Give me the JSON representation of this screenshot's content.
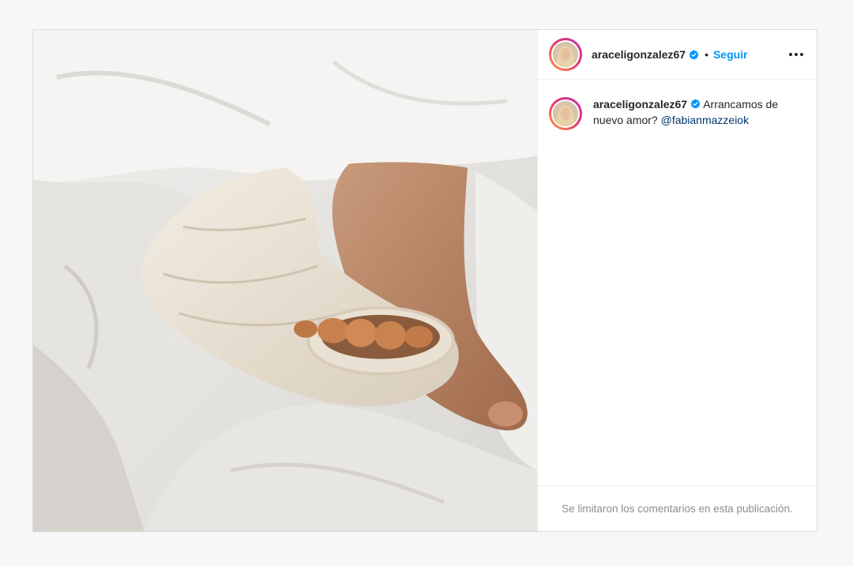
{
  "post": {
    "username": "araceligonzalez67",
    "separator": "•",
    "follow_label": "Seguir",
    "more_icon": "more-horizontal-icon",
    "verified_icon": "verified-badge-icon",
    "photo_description_icon": "post-photo",
    "caption": {
      "username": "araceligonzalez67",
      "text": "Arrancamos de nuevo amor?",
      "mention": "@fabianmazzeiok"
    },
    "comments_notice": "Se limitaron los comentarios en esta publicación."
  },
  "colors": {
    "link_blue": "#0095f6",
    "mention_blue": "#00376b",
    "verified_blue": "#0095f6",
    "muted_text": "#8e8e8e"
  }
}
